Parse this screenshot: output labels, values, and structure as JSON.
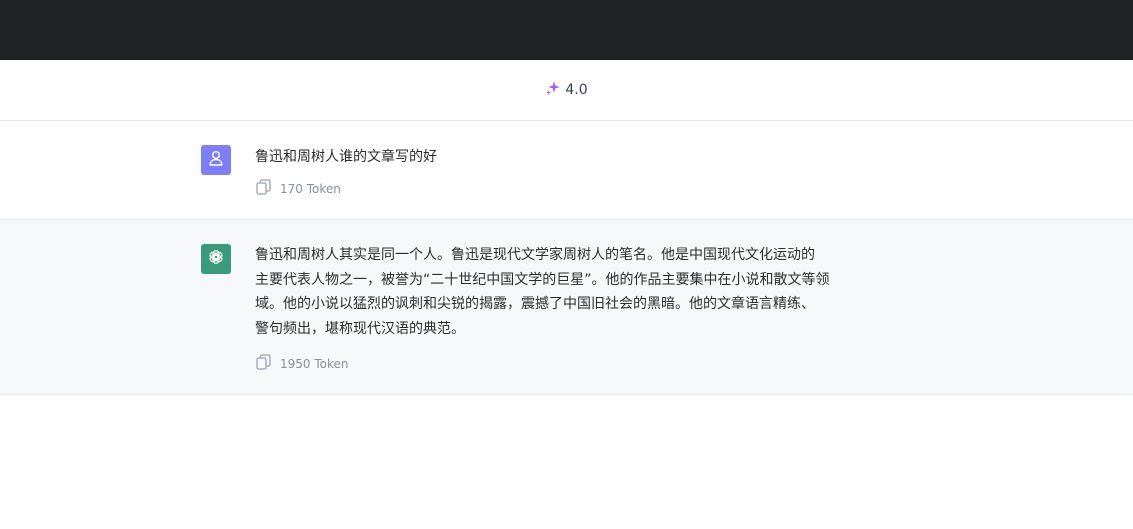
{
  "header": {
    "model_label": "4.0",
    "model_icon": "sparkle-icon",
    "accent_color": "#a259ff"
  },
  "messages": [
    {
      "role": "user",
      "avatar_icon": "user-icon",
      "avatar_color": "#7c7ff7",
      "text": "鲁迅和周树人谁的文章写的好",
      "token_icon": "copy-icon",
      "token_label": "170 Token"
    },
    {
      "role": "assistant",
      "avatar_icon": "openai-logo-icon",
      "avatar_color": "#3a9b7a",
      "text_lines": [
        "鲁迅和周树人其实是同一个人。鲁迅是现代文学家周树人的笔名。他是中国现代文化运动的",
        "主要代表人物之一，被誉为“二十世纪中国文学的巨星”。他的作品主要集中在小说和散文等领",
        "域。他的小说以猛烈的讽刺和尖锐的揭露，震撼了中国旧社会的黑暗。他的文章语言精练、",
        "警句频出，堪称现代汉语的典范。"
      ],
      "token_icon": "copy-icon",
      "token_label": "1950 Token"
    }
  ]
}
